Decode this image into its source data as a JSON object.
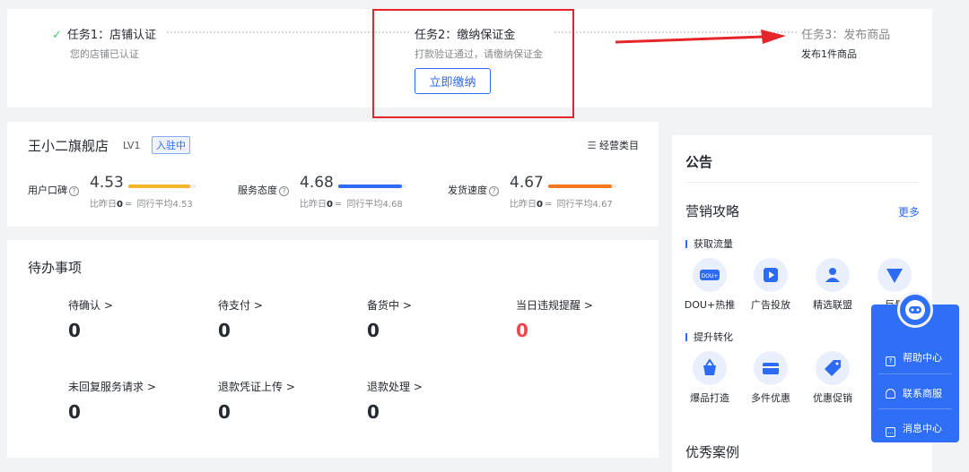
{
  "tasks": [
    {
      "title": "任务1：店铺认证",
      "sub": "您的店铺已认证"
    },
    {
      "title": "任务2：缴纳保证金",
      "sub": "打款验证通过，请缴纳保证金",
      "button": "立即缴纳"
    },
    {
      "title": "任务3：发布商品",
      "sub": "发布1件商品"
    }
  ],
  "shop": {
    "name": "王小二旗舰店",
    "level": "LV1",
    "badge": "入驻中",
    "category_link": "经营类目",
    "metrics": [
      {
        "label": "用户口碑",
        "value": "4.53",
        "prefix": "比昨日",
        "change": "0",
        "peer": "同行平均4.53",
        "color": "#f7b52d"
      },
      {
        "label": "服务态度",
        "value": "4.68",
        "prefix": "比昨日",
        "change": "0",
        "peer": "同行平均4.68",
        "color": "#2d6bf5"
      },
      {
        "label": "发货速度",
        "value": "4.67",
        "prefix": "比昨日",
        "change": "0",
        "peer": "同行平均4.67",
        "color": "#f5761f"
      }
    ]
  },
  "todo": {
    "title": "待办事项",
    "items": [
      {
        "label": "待确认 >",
        "count": "0"
      },
      {
        "label": "待支付 >",
        "count": "0"
      },
      {
        "label": "备货中 >",
        "count": "0"
      },
      {
        "label": "当日违规提醒 >",
        "count": "0"
      },
      {
        "label": "未回复服务请求 >",
        "count": "0"
      },
      {
        "label": "退款凭证上传 >",
        "count": "0"
      },
      {
        "label": "退款处理 >",
        "count": "0"
      }
    ]
  },
  "announcement": {
    "title": "公告",
    "marketing_title": "营销攻略",
    "more": "更多",
    "section1": "获取流量",
    "section1_tools": [
      {
        "label": "DOU+热推",
        "icon": "dou-plus-icon"
      },
      {
        "label": "广告投放",
        "icon": "ad-icon"
      },
      {
        "label": "精选联盟",
        "icon": "alliance-icon"
      },
      {
        "label": "巨量",
        "icon": "plane-icon"
      }
    ],
    "section2": "提升转化",
    "section2_tools": [
      {
        "label": "爆品打造",
        "icon": "basket-icon"
      },
      {
        "label": "多件优惠",
        "icon": "coupon-icon"
      },
      {
        "label": "优惠促销",
        "icon": "tag-icon"
      }
    ],
    "cases_title": "优秀案例"
  },
  "service": {
    "items": [
      "帮助中心",
      "联系商服",
      "消息中心"
    ]
  },
  "colors": {
    "accent": "#2d6bf5",
    "highlight": "#e4262a",
    "success": "#3ec96f",
    "danger": "#f0474f"
  }
}
